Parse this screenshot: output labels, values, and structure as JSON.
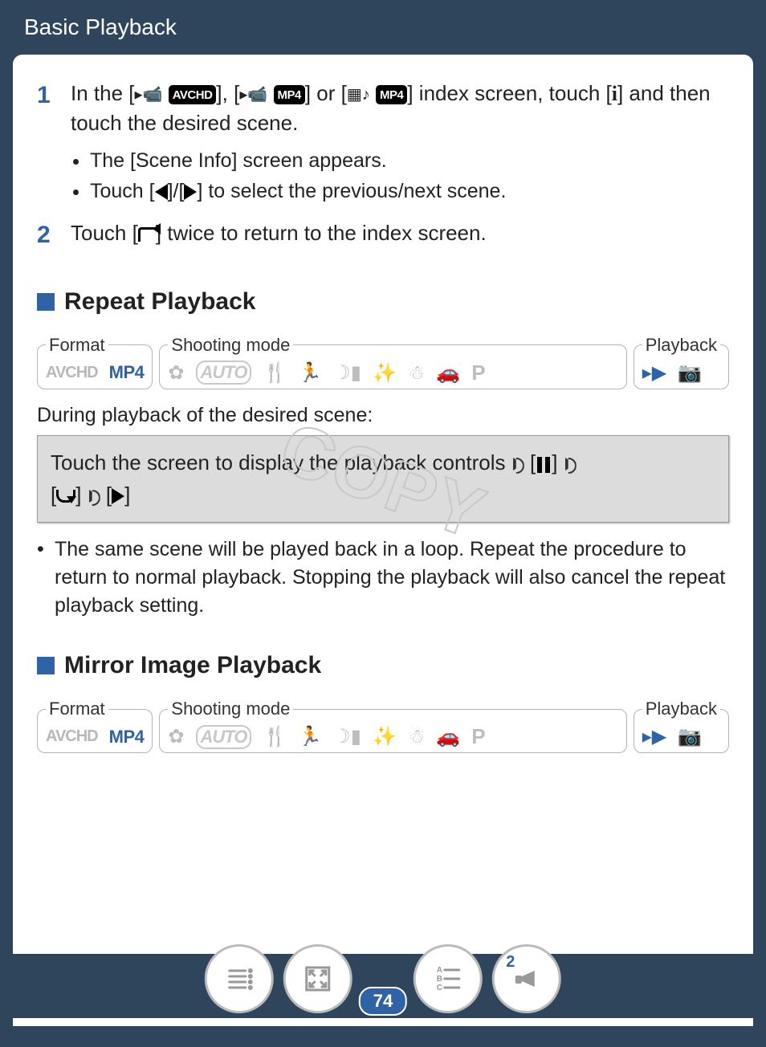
{
  "header": {
    "title": "Basic Playback"
  },
  "steps": {
    "s1": {
      "num": "1",
      "text_a": "In the [",
      "text_b": "], [",
      "text_c": "] or [",
      "text_d": "] index screen, touch [",
      "text_e": "] and then touch the desired scene.",
      "badge_avchd": "AVCHD",
      "badge_mp4_1": "MP4",
      "badge_mp4_2": "MP4",
      "info": "i",
      "bullet1": "The [Scene Info] screen appears.",
      "bullet2_a": "Touch [",
      "bullet2_b": "]/[",
      "bullet2_c": "] to select the previous/next scene."
    },
    "s2": {
      "num": "2",
      "text_a": "Touch [",
      "text_b": "] twice to return to the index screen."
    }
  },
  "section1": {
    "title": "Repeat Playback"
  },
  "section2": {
    "title": "Mirror Image Playback"
  },
  "modebar_labels": {
    "format": "Format",
    "shooting": "Shooting mode",
    "playback": "Playback"
  },
  "formats": {
    "avchd": "AVCHD",
    "mp4": "MP4"
  },
  "shooting_auto": "AUTO",
  "shooting_p": "P",
  "lead": "During playback of the desired scene:",
  "graybox": {
    "t1": "Touch the screen to display the playback controls ",
    "t2": " [",
    "t3": "] ",
    "t4": " [",
    "t5": "] ",
    "t6": " [",
    "t7": "]"
  },
  "note": "The same scene will be played back in a loop. Repeat the procedure to return to normal playback. Stopping the playback will also cancel the repeat playback setting.",
  "watermark": "COPY",
  "footer": {
    "pagenum": "74",
    "badge2": "2",
    "abc": {
      "a": "A",
      "b": "B",
      "c": "C"
    }
  }
}
